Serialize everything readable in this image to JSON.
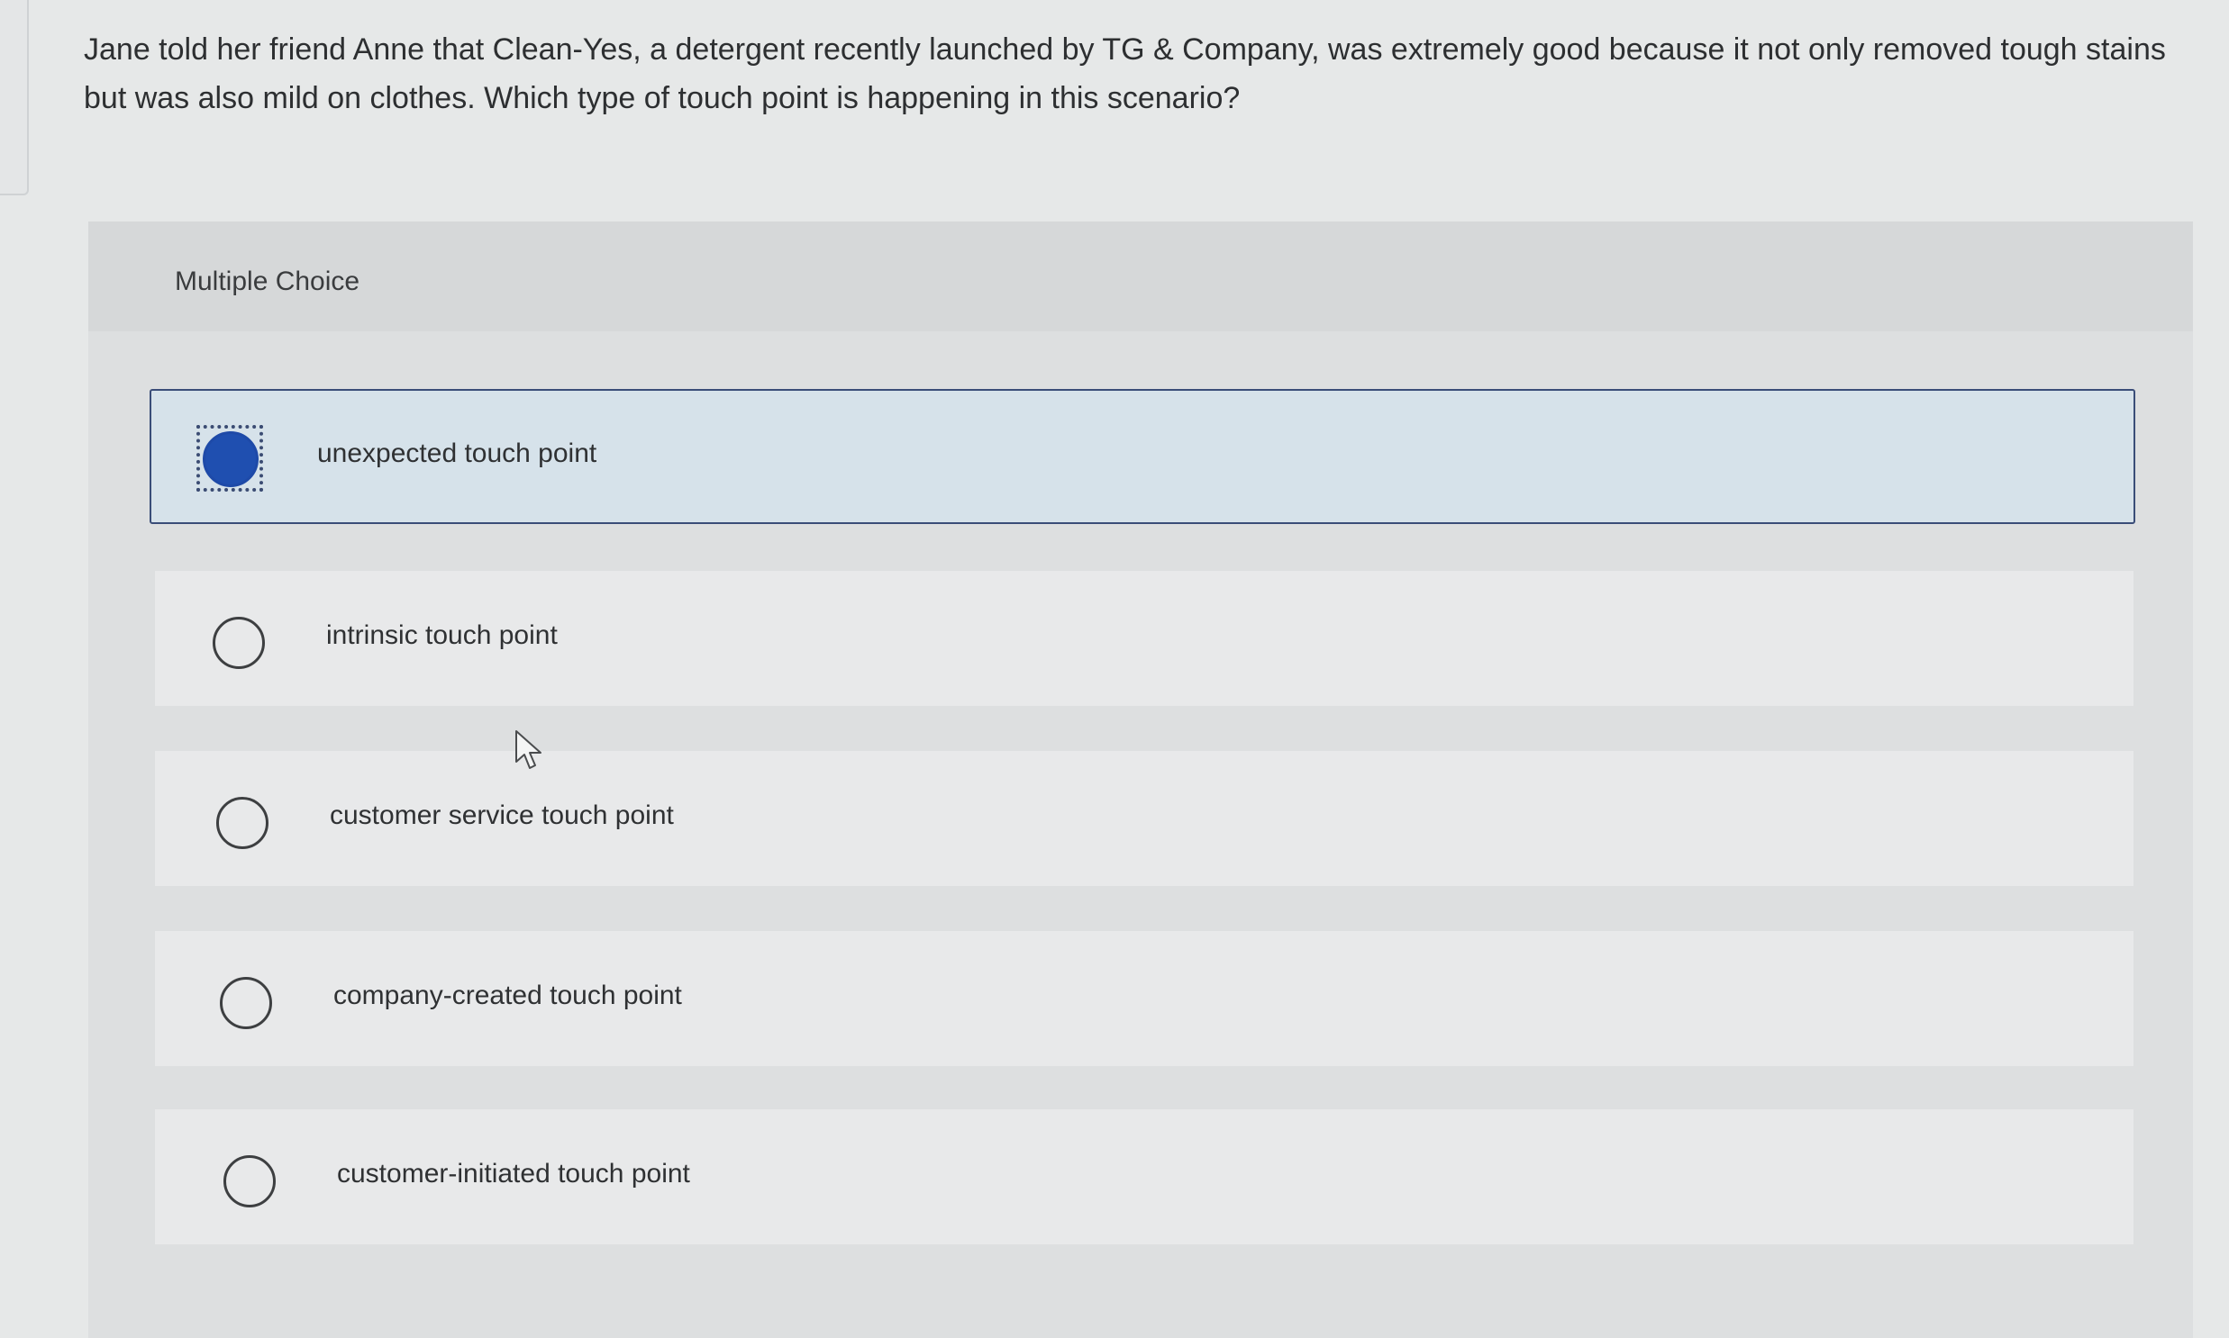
{
  "question": {
    "text": "Jane told her friend Anne that Clean-Yes, a detergent recently launched by TG & Company, was extremely good because it not only removed tough stains but was also mild on clothes. Which type of touch point is happening in this scenario?"
  },
  "multiple_choice": {
    "title": "Multiple Choice",
    "options": [
      {
        "label": "unexpected touch point",
        "selected": true
      },
      {
        "label": "intrinsic touch point",
        "selected": false
      },
      {
        "label": "customer service touch point",
        "selected": false
      },
      {
        "label": "company-created touch point",
        "selected": false
      },
      {
        "label": "customer-initiated touch point",
        "selected": false
      }
    ]
  },
  "colors": {
    "selected_fill": "#1f4fb0",
    "selected_background": "#d6e2ea",
    "selected_border": "#3a4d78"
  },
  "icons": {
    "cursor": "mouse-pointer-icon"
  }
}
